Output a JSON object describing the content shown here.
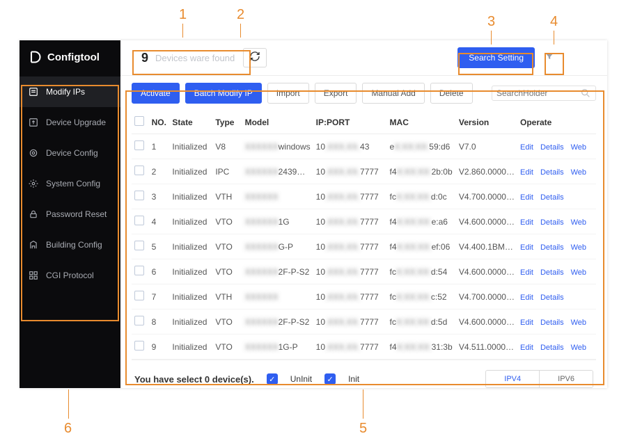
{
  "callouts": {
    "c1": "1",
    "c2": "2",
    "c3": "3",
    "c4": "4",
    "c5": "5",
    "c6": "6"
  },
  "brand": {
    "name": "Configtool"
  },
  "sidebar": {
    "items": [
      {
        "label": "Modify IPs",
        "icon": "modify-ips-icon"
      },
      {
        "label": "Device Upgrade",
        "icon": "upgrade-icon"
      },
      {
        "label": "Device Config",
        "icon": "device-config-icon"
      },
      {
        "label": "System Config",
        "icon": "system-config-icon"
      },
      {
        "label": "Password Reset",
        "icon": "lock-icon"
      },
      {
        "label": "Building Config",
        "icon": "building-icon"
      },
      {
        "label": "CGI Protocol",
        "icon": "grid-icon"
      }
    ]
  },
  "topbar": {
    "count": "9",
    "count_text": "Devices ware found",
    "search_setting": "Search Setting"
  },
  "toolbar": {
    "activate": "Activate",
    "batch": "Batch Modify IP",
    "import": "Import",
    "export": "Export",
    "manual": "Manual Add",
    "delete": "Delete",
    "search_placeholder": "SearchHolder"
  },
  "table": {
    "headers": {
      "no": "NO.",
      "state": "State",
      "type": "Type",
      "model": "Model",
      "ipport": "IP:PORT",
      "mac": "MAC",
      "version": "Version",
      "operate": "Operate"
    },
    "ops": {
      "edit": "Edit",
      "details": "Details",
      "web": "Web"
    },
    "rows": [
      {
        "no": "1",
        "state": "Initialized",
        "type": "V8",
        "model": "windows",
        "ip_a": "10",
        "ip_b": "43",
        "mac_a": "e",
        "mac_b": "59:d6",
        "version": "V7.0",
        "web": true
      },
      {
        "no": "2",
        "state": "Initialized",
        "type": "IPC",
        "model": "2439…",
        "ip_a": "10",
        "ip_b": "7777",
        "mac_a": "f4",
        "mac_b": "2b:0b",
        "version": "V2.860.0000…",
        "web": true
      },
      {
        "no": "3",
        "state": "Initialized",
        "type": "VTH",
        "model": "",
        "ip_a": "10",
        "ip_b": "7777",
        "mac_a": "fc",
        "mac_b": "d:0c",
        "version": "V4.700.0000…",
        "web": false
      },
      {
        "no": "4",
        "state": "Initialized",
        "type": "VTO",
        "model": "1G",
        "ip_a": "10",
        "ip_b": "7777",
        "mac_a": "f4",
        "mac_b": "e:a6",
        "version": "V4.600.0000…",
        "web": true
      },
      {
        "no": "5",
        "state": "Initialized",
        "type": "VTO",
        "model": "G-P",
        "ip_a": "10",
        "ip_b": "7777",
        "mac_a": "f4",
        "mac_b": "ef:06",
        "version": "V4.400.1BM…",
        "web": true
      },
      {
        "no": "6",
        "state": "Initialized",
        "type": "VTO",
        "model": "2F-P-S2",
        "ip_a": "10",
        "ip_b": "7777",
        "mac_a": "fc",
        "mac_b": "d:54",
        "version": "V4.600.0000…",
        "web": true
      },
      {
        "no": "7",
        "state": "Initialized",
        "type": "VTH",
        "model": "",
        "ip_a": "10",
        "ip_b": "7777",
        "mac_a": "fc",
        "mac_b": "c:52",
        "version": "V4.700.0000…",
        "web": false
      },
      {
        "no": "8",
        "state": "Initialized",
        "type": "VTO",
        "model": "2F-P-S2",
        "ip_a": "10",
        "ip_b": "7777",
        "mac_a": "fc",
        "mac_b": "d:5d",
        "version": "V4.600.0000…",
        "web": true
      },
      {
        "no": "9",
        "state": "Initialized",
        "type": "VTO",
        "model": "1G-P",
        "ip_a": "10",
        "ip_b": "7777",
        "mac_a": "f4",
        "mac_b": "31:3b",
        "version": "V4.511.0000…",
        "web": true
      }
    ]
  },
  "footer": {
    "selected_msg": "You have select 0 device(s).",
    "uninit": "UnInit",
    "init": "Init",
    "ipv4": "IPV4",
    "ipv6": "IPV6"
  }
}
